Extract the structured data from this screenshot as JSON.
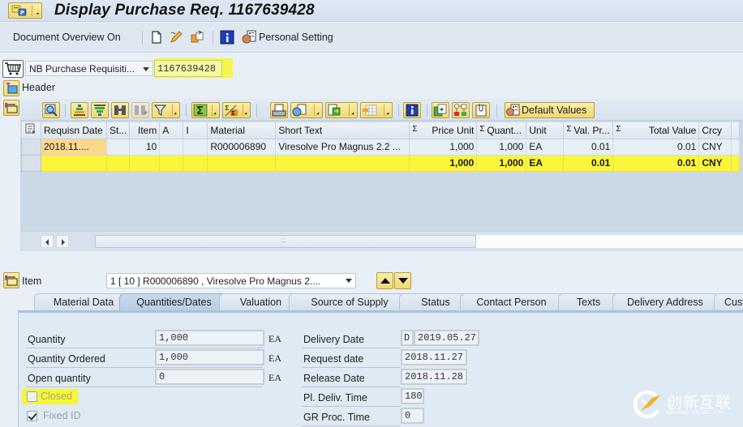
{
  "window": {
    "title": "Display Purchase Req. 1167639428"
  },
  "app_toolbar": {
    "document_overview": "Document Overview On",
    "personal_setting": "Personal Setting"
  },
  "header_area": {
    "doc_type": "NB Purchase Requisiti...",
    "doc_number": "1167639428",
    "header_label": "Header"
  },
  "alv_toolbar": {
    "default_values": "Default Values"
  },
  "items_table": {
    "columns": [
      {
        "label": "Requisn Date",
        "sigma": false
      },
      {
        "label": "St...",
        "sigma": false
      },
      {
        "label": "Item",
        "sigma": false
      },
      {
        "label": "A",
        "sigma": false
      },
      {
        "label": "I",
        "sigma": false
      },
      {
        "label": "Material",
        "sigma": false
      },
      {
        "label": "Short Text",
        "sigma": false
      },
      {
        "label": "Price Unit",
        "sigma": true
      },
      {
        "label": "Quant...",
        "sigma": true
      },
      {
        "label": "Unit",
        "sigma": false
      },
      {
        "label": "Val. Pr...",
        "sigma": true
      },
      {
        "label": "Total Value",
        "sigma": true
      },
      {
        "label": "Crcy",
        "sigma": false
      }
    ],
    "sigma_symbol": "Σ",
    "rows": [
      {
        "requisn_date": "2018.11....",
        "status": "",
        "item": "10",
        "a": "",
        "i": "",
        "material": "R000006890",
        "short_text": "Viresolve Pro Magnus 2.2 ...",
        "price_unit": "1,000",
        "quantity": "1,000",
        "unit": "EA",
        "val_price": "0.01",
        "total_value": "0.01",
        "currency": "CNY"
      }
    ],
    "totals": {
      "price_unit": "1,000",
      "quantity": "1,000",
      "unit": "EA",
      "val_price": "0.01",
      "total_value": "0.01",
      "currency": "CNY"
    }
  },
  "item_section": {
    "label": "Item",
    "selected_item": "1 [ 10 ] R000006890 , Viresolve Pro Magnus 2...."
  },
  "tabs": [
    {
      "label": "Material Data",
      "active": false
    },
    {
      "label": "Quantities/Dates",
      "active": true
    },
    {
      "label": "Valuation",
      "active": false
    },
    {
      "label": "Source of Supply",
      "active": false
    },
    {
      "label": "Status",
      "active": false
    },
    {
      "label": "Contact Person",
      "active": false
    },
    {
      "label": "Texts",
      "active": false
    },
    {
      "label": "Delivery Address",
      "active": false
    },
    {
      "label": "Cust",
      "active": false
    }
  ],
  "quantities": {
    "quantity": {
      "label": "Quantity",
      "value": "1,000",
      "unit": "EA"
    },
    "quantity_ordered": {
      "label": "Quantity Ordered",
      "value": "1,000",
      "unit": "EA"
    },
    "open_quantity": {
      "label": "Open quantity",
      "value": "0",
      "unit": "EA"
    },
    "closed": {
      "label": "Closed",
      "checked": false
    },
    "fixed_id": {
      "label": "Fixed ID",
      "checked": true
    }
  },
  "dates": {
    "delivery_date": {
      "label": "Delivery Date",
      "format": "D",
      "value": "2019.05.27"
    },
    "request_date": {
      "label": "Request date",
      "value": "2018.11.27"
    },
    "release_date": {
      "label": "Release Date",
      "value": "2018.11.28"
    },
    "pl_deliv_time": {
      "label": "Pl. Deliv. Time",
      "value": "180"
    },
    "gr_proc_time": {
      "label": "GR Proc. Time",
      "value": "0"
    }
  },
  "watermark": {
    "text": "创新互联",
    "subtext": "CHUANG XIN HU LIAN"
  },
  "colors": {
    "highlight_yellow": "#f6f63a",
    "sap_button_gold": "#efd773",
    "active_tab": "#b7cde4"
  }
}
